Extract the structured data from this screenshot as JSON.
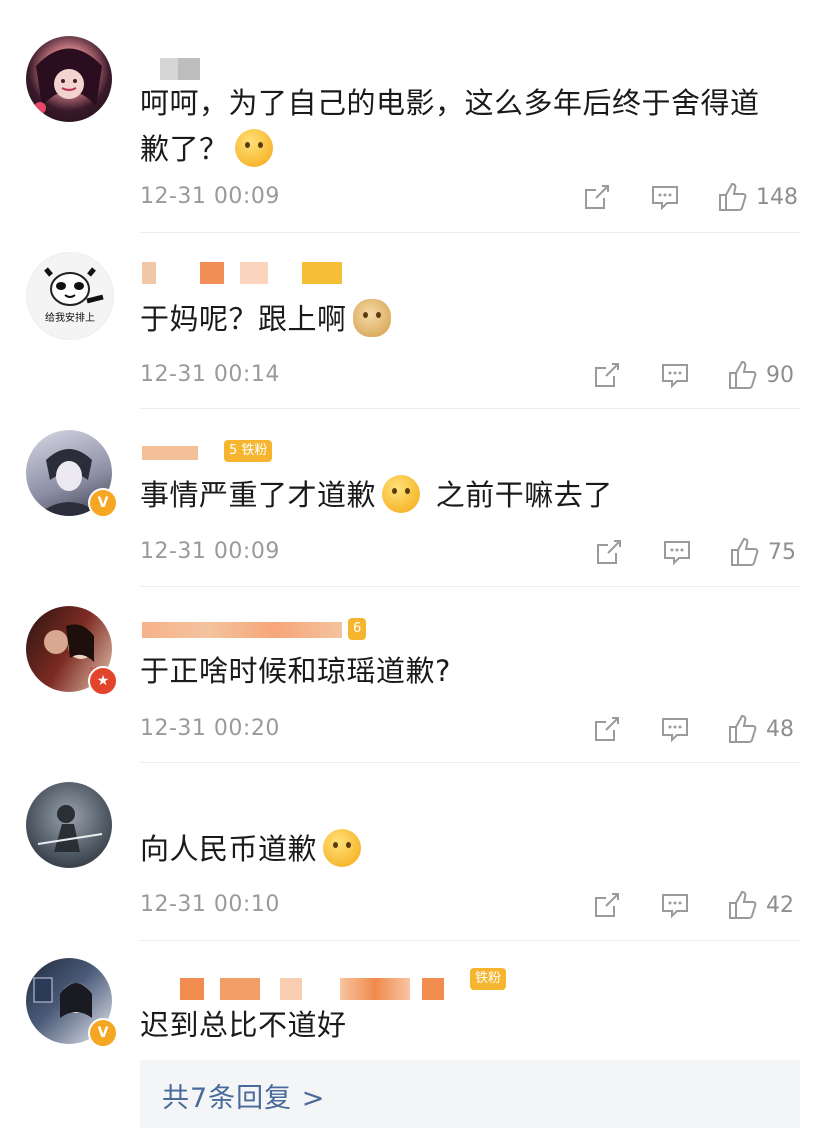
{
  "comments": [
    {
      "id": "c1",
      "text": "呵呵，为了自己的电影，这么多年后终于舍得道歉了？",
      "emoji": "hug-emoji",
      "time": "12-31 00:09",
      "likes": "148"
    },
    {
      "id": "c2",
      "text": "于妈呢？跟上啊",
      "emoji": "doge-emoji",
      "time": "12-31 00:14",
      "likes": "90",
      "avatar_caption": "给我安排上"
    },
    {
      "id": "c3",
      "text_before": "事情严重了才道歉",
      "text_after": "之前干嘛去了",
      "emoji": "sweat-emoji",
      "time": "12-31 00:09",
      "likes": "75",
      "badge": "V",
      "tag": "5 铁粉"
    },
    {
      "id": "c4",
      "text": "于正啥时候和琼瑶道歉?",
      "time": "12-31 00:20",
      "likes": "48",
      "tag": "6"
    },
    {
      "id": "c5",
      "text": "向人民币道歉",
      "emoji": "smile-emoji",
      "time": "12-31 00:10",
      "likes": "42"
    },
    {
      "id": "c6",
      "text": "迟到总比不道好",
      "badge": "V",
      "tag": "铁粉"
    }
  ],
  "replies_link": "共7条回复 >",
  "colors": {
    "accent": "#f5a623",
    "link": "#4a6a9b",
    "meta": "#9a9a9a"
  }
}
